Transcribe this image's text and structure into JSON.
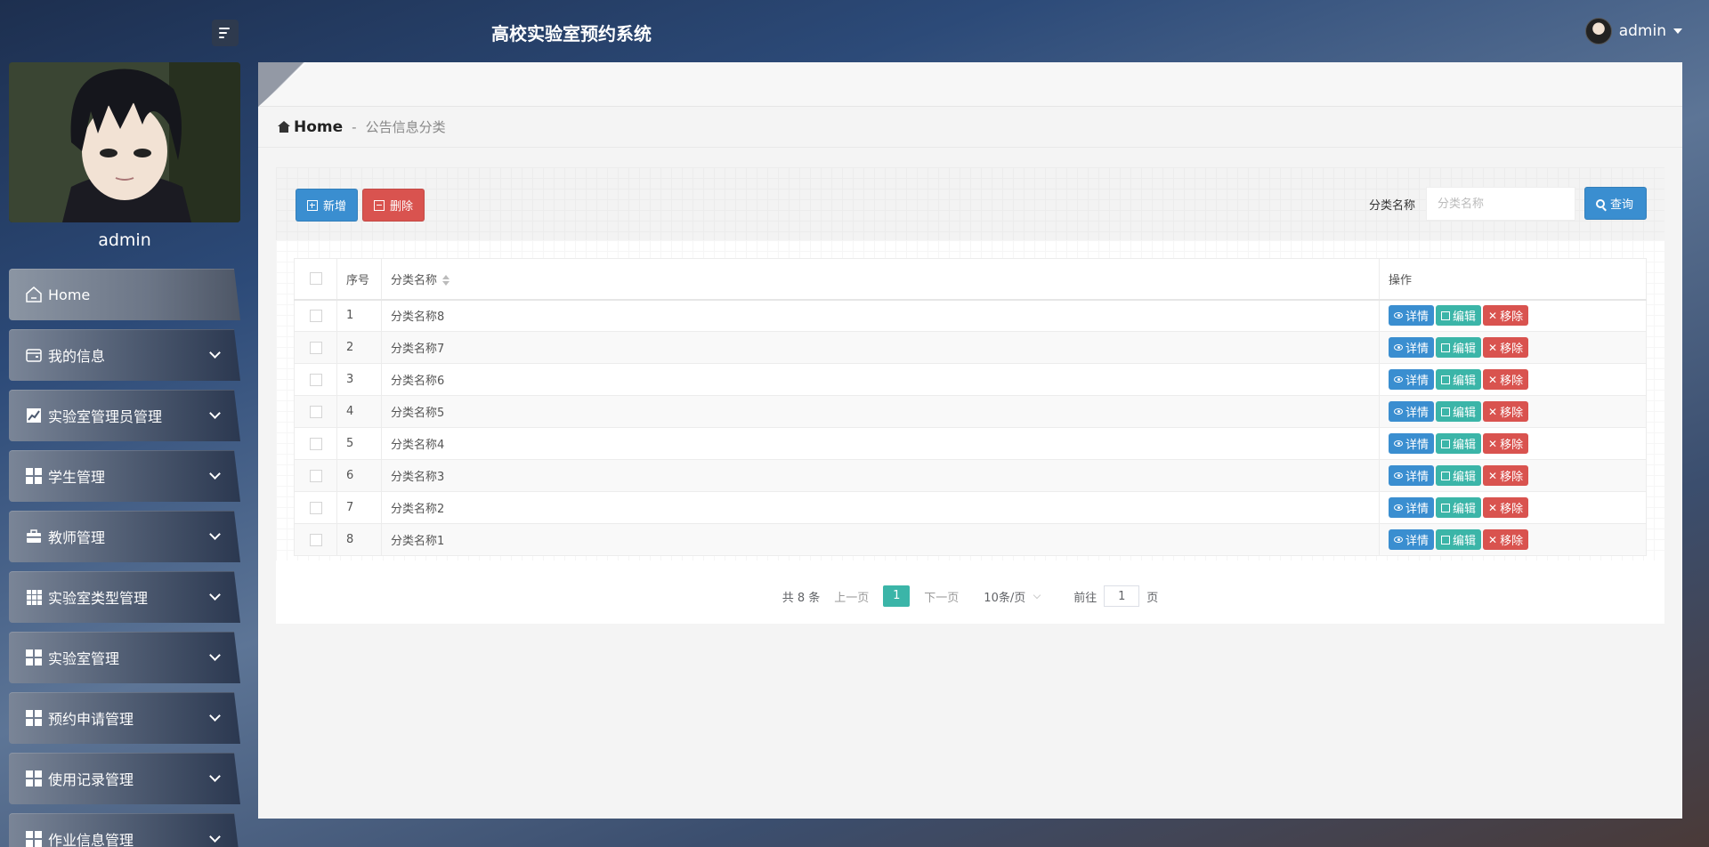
{
  "header": {
    "app_title": "高校实验室预约系统",
    "username": "admin"
  },
  "sidebar": {
    "profile_name": "admin",
    "items": [
      {
        "label": "Home"
      },
      {
        "label": "我的信息"
      },
      {
        "label": "实验室管理员管理"
      },
      {
        "label": "学生管理"
      },
      {
        "label": "教师管理"
      },
      {
        "label": "实验室类型管理"
      },
      {
        "label": "实验室管理"
      },
      {
        "label": "预约申请管理"
      },
      {
        "label": "使用记录管理"
      },
      {
        "label": "作业信息管理"
      }
    ]
  },
  "breadcrumb": {
    "home": "Home",
    "separator": "-",
    "current": "公告信息分类"
  },
  "toolbar": {
    "add_label": "新增",
    "delete_label": "删除",
    "search_label": "分类名称",
    "search_placeholder": "分类名称",
    "search_button": "查询"
  },
  "table": {
    "headers": {
      "index": "序号",
      "name": "分类名称",
      "ops": "操作"
    },
    "ops": {
      "view": "详情",
      "edit": "编辑",
      "remove": "移除"
    },
    "rows": [
      {
        "index": "1",
        "name": "分类名称8"
      },
      {
        "index": "2",
        "name": "分类名称7"
      },
      {
        "index": "3",
        "name": "分类名称6"
      },
      {
        "index": "4",
        "name": "分类名称5"
      },
      {
        "index": "5",
        "name": "分类名称4"
      },
      {
        "index": "6",
        "name": "分类名称3"
      },
      {
        "index": "7",
        "name": "分类名称2"
      },
      {
        "index": "8",
        "name": "分类名称1"
      }
    ]
  },
  "pager": {
    "total": "共 8 条",
    "prev": "上一页",
    "current_page": "1",
    "next": "下一页",
    "page_size": "10条/页",
    "goto_label": "前往",
    "goto_value": "1",
    "goto_suffix": "页"
  },
  "colors": {
    "primary": "#3a8ed0",
    "danger": "#d9534f",
    "teal": "#3bb5a8"
  }
}
